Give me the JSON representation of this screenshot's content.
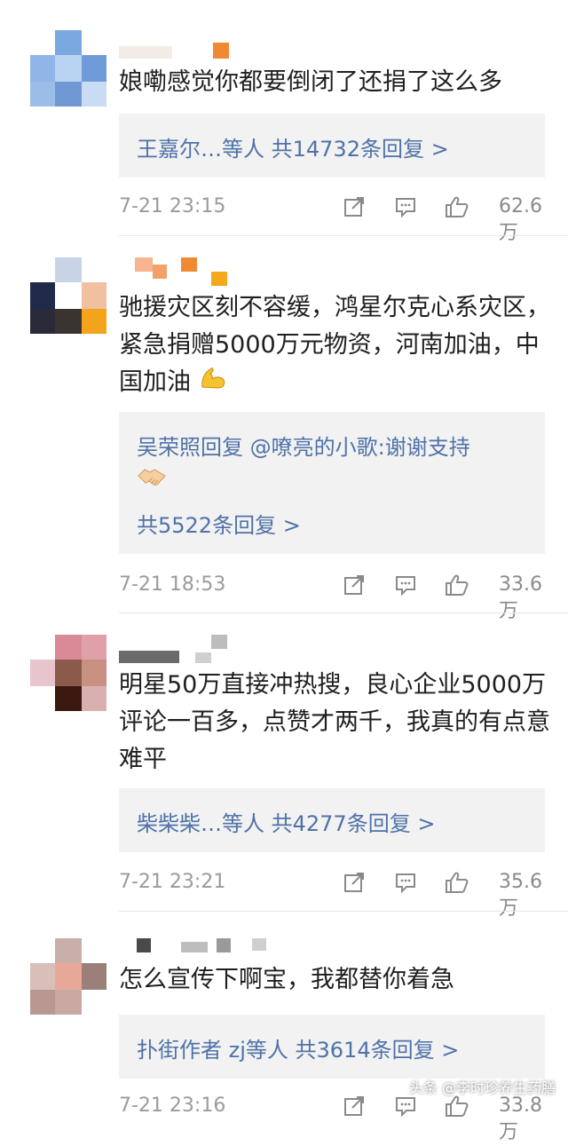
{
  "comments": [
    {
      "text": "娘嘞感觉你都要倒闭了还捐了这么多",
      "reply_line": "王嘉尔…等人  共14732条回复 >",
      "time": "7-21 23:15",
      "likes": "62.6万"
    },
    {
      "text": "驰援灾区刻不容缓，鸿星尔克心系灾区，紧急捐赠5000万元物资，河南加油，中国加油",
      "emoji_name": "flexed-biceps",
      "reply_line": "吴荣照回复 @嘹亮的小歌:谢谢支持",
      "reply_emoji_name": "handshake",
      "reply_count": "共5522条回复 >",
      "time": "7-21 18:53",
      "likes": "33.6万"
    },
    {
      "text": "明星50万直接冲热搜，良心企业5000万评论一百多，点赞才两千，我真的有点意难平",
      "reply_line": "柴柴柴…等人  共4277条回复 >",
      "time": "7-21 23:21",
      "likes": "35.6万"
    },
    {
      "text": "怎么宣传下啊宝，我都替你着急",
      "reply_line": "扑街作者 zj等人  共3614条回复 >",
      "time": "7-21 23:16",
      "likes": "33.8万"
    }
  ],
  "watermark": "头条 @李时珍养生药膳",
  "colors": {
    "link": "#4f72a8",
    "meta": "#9b9b9b",
    "reply_bg": "#f2f2f2"
  }
}
